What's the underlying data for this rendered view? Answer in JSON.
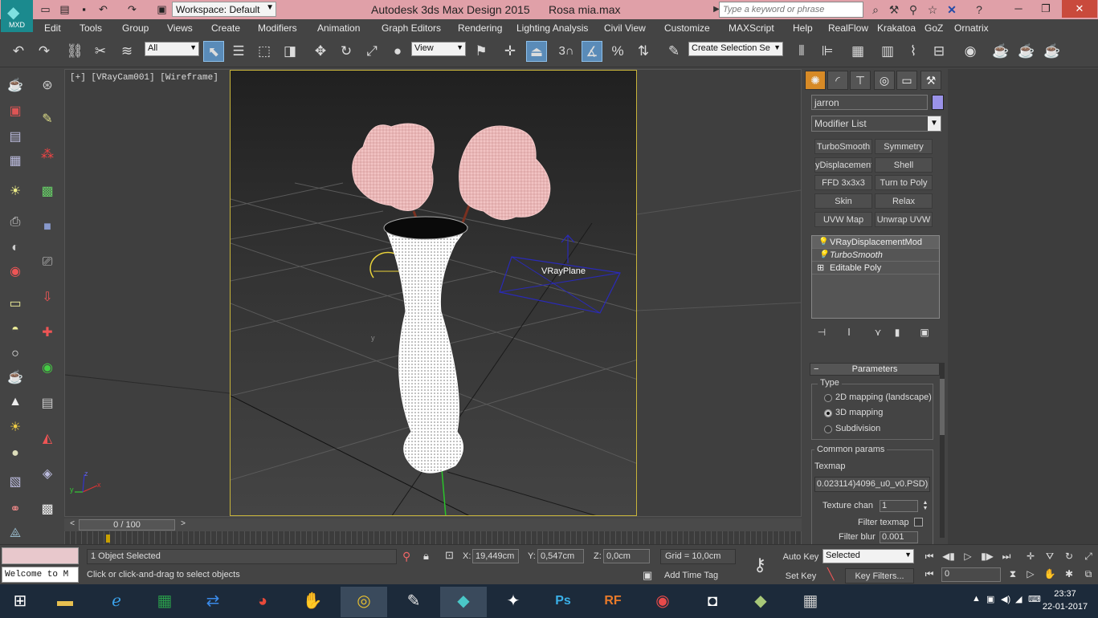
{
  "app": {
    "logo_text": "MXD",
    "workspace_label": "Workspace: Default",
    "window_title": "Autodesk 3ds Max Design 2015      Rosa mia.max",
    "search_placeholder": "Type a keyword or phrase"
  },
  "menu": [
    "Edit",
    "Tools",
    "Group",
    "Views",
    "Create",
    "Modifiers",
    "Animation",
    "Graph Editors",
    "Rendering",
    "Lighting Analysis",
    "Civil View",
    "Customize",
    "MAXScript",
    "Help",
    "RealFlow",
    "Krakatoa",
    "GoZ",
    "Ornatrix"
  ],
  "toolbar": {
    "selection_filter": "All",
    "reference_coord": "View",
    "snap_number": "3",
    "named_selection": "Create Selection Se"
  },
  "viewport": {
    "label": "[+] [VRayCam001] [Wireframe]",
    "vray_plane_label": "VRayPlane",
    "axis_x": "x",
    "axis_y": "y",
    "axis_z": "z"
  },
  "command_panel": {
    "object_name": "jarron",
    "object_color": "#9a92e8",
    "modifier_list": "Modifier List",
    "modifier_buttons": [
      "TurboSmooth",
      "Symmetry",
      "yDisplacement",
      "Shell",
      "FFD 3x3x3",
      "Turn to Poly",
      "Skin",
      "Relax",
      "UVW Map",
      "Unwrap UVW"
    ],
    "stack": [
      "VRayDisplacementMod",
      "TurboSmooth",
      "Editable Poly"
    ],
    "parameters": {
      "title": "Parameters",
      "type_group": "Type",
      "type_options": [
        "2D mapping (landscape)",
        "3D mapping",
        "Subdivision"
      ],
      "type_selected": "3D mapping",
      "common_group": "Common params",
      "texmap_label": "Texmap",
      "texmap_value": "0.023114)4096_u0_v0.PSD)",
      "texture_chan_label": "Texture chan",
      "texture_chan_value": "1",
      "filter_texmap_label": "Filter texmap",
      "filter_blur_label": "Filter blur",
      "filter_blur_value": "0.001"
    }
  },
  "timeline": {
    "slider_label": "0 / 100",
    "prev": "<",
    "next": ">"
  },
  "status": {
    "listener_text": "Welcome to M",
    "selection": "1 Object Selected",
    "prompt": "Click or click-and-drag to select objects",
    "x_label": "X:",
    "x_value": "19,449cm",
    "y_label": "Y:",
    "y_value": "0,547cm",
    "z_label": "Z:",
    "z_value": "0,0cm",
    "grid": "Grid = 10,0cm",
    "add_time_tag": "Add Time Tag",
    "auto_key": "Auto Key",
    "set_key": "Set Key",
    "key_mode": "Selected",
    "key_filters": "Key Filters...",
    "frame": "0"
  },
  "taskbar": {
    "time": "23:37",
    "date": "22-01-2017"
  }
}
